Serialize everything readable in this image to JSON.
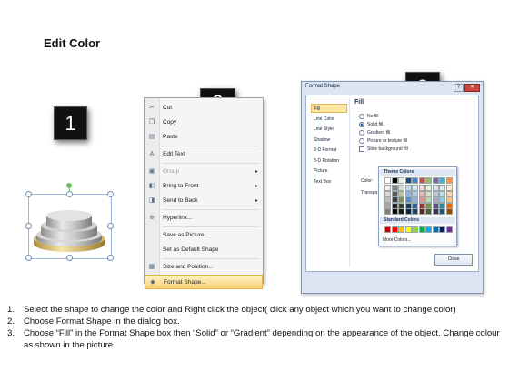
{
  "page": {
    "title": "Edit Color",
    "badges": [
      "1",
      "2",
      "3"
    ]
  },
  "context_menu": {
    "items": [
      {
        "label": "Cut",
        "icon": "scissors-icon",
        "glyph": "✂"
      },
      {
        "label": "Copy",
        "icon": "copy-icon",
        "glyph": "❐"
      },
      {
        "label": "Paste",
        "icon": "paste-icon",
        "glyph": "▤"
      },
      {
        "label": "Edit Text",
        "icon": "edit-text-icon",
        "glyph": "A"
      },
      {
        "label": "Group",
        "icon": "group-icon",
        "glyph": "▣",
        "disabled": true,
        "submenu": true
      },
      {
        "label": "Bring to Front",
        "icon": "bring-front-icon",
        "glyph": "◧",
        "submenu": true
      },
      {
        "label": "Send to Back",
        "icon": "send-back-icon",
        "glyph": "◨",
        "submenu": true
      },
      {
        "label": "Hyperlink...",
        "icon": "hyperlink-icon",
        "glyph": "⊕"
      },
      {
        "label": "Save as Picture...",
        "icon": "",
        "glyph": ""
      },
      {
        "label": "Set as Default Shape",
        "icon": "",
        "glyph": ""
      },
      {
        "label": "Size and Position...",
        "icon": "size-position-icon",
        "glyph": "▦"
      },
      {
        "label": "Format Shape...",
        "icon": "format-shape-icon",
        "glyph": "◆",
        "highlighted": true
      }
    ]
  },
  "dialog": {
    "title": "Format Shape",
    "help_label": "?",
    "close_label": "✕",
    "nav_items": [
      "Fill",
      "Line Color",
      "Line Style",
      "Shadow",
      "3-D Format",
      "3-D Rotation",
      "Picture",
      "Text Box"
    ],
    "fill_heading": "Fill",
    "options": [
      {
        "label": "No fill",
        "type": "radio",
        "selected": false
      },
      {
        "label": "Solid fill",
        "type": "radio",
        "selected": true
      },
      {
        "label": "Gradient fill",
        "type": "radio",
        "selected": false
      },
      {
        "label": "Picture or texture fill",
        "type": "radio",
        "selected": false
      },
      {
        "label": "Slide background fill",
        "type": "checkbox",
        "selected": false
      }
    ],
    "color_label": "Color:",
    "transparency_label": "Transpa",
    "close_button": "Close"
  },
  "picker": {
    "theme_label": "Theme Colors",
    "standard_label": "Standard Colors",
    "more_label": "More Colors...",
    "theme_top": [
      "#ffffff",
      "#000000",
      "#eeece1",
      "#1f497d",
      "#4f81bd",
      "#c0504d",
      "#9bbb59",
      "#8064a2",
      "#4bacc6",
      "#f79646"
    ],
    "theme_shades": [
      [
        "#f2f2f2",
        "#7f7f7f",
        "#ddd9c3",
        "#c6d9f0",
        "#dbe5f1",
        "#f2dcdb",
        "#ebf1dd",
        "#e5e0ec",
        "#dbeef3",
        "#fdeada"
      ],
      [
        "#d8d8d8",
        "#595959",
        "#c4bd97",
        "#8db3e2",
        "#b8cce4",
        "#e5b9b7",
        "#d7e3bc",
        "#ccc1d9",
        "#b7dde8",
        "#fbd5b5"
      ],
      [
        "#bfbfbf",
        "#3f3f3f",
        "#938953",
        "#548dd4",
        "#95b3d7",
        "#d99694",
        "#c3d69b",
        "#b2a2c7",
        "#92cddc",
        "#fac08f"
      ],
      [
        "#a5a5a5",
        "#262626",
        "#494429",
        "#17365d",
        "#366092",
        "#953734",
        "#76923c",
        "#5f497a",
        "#31859b",
        "#e36c09"
      ],
      [
        "#7f7f7f",
        "#0c0c0c",
        "#1d1b10",
        "#0f243e",
        "#244061",
        "#632423",
        "#4f6128",
        "#3f3151",
        "#205867",
        "#974806"
      ]
    ],
    "standard": [
      "#c00000",
      "#ff0000",
      "#ffc000",
      "#ffff00",
      "#92d050",
      "#00b050",
      "#00b0f0",
      "#0070c0",
      "#002060",
      "#7030a0"
    ]
  },
  "instructions": [
    {
      "num": "1.",
      "text": "Select the shape to change the color and Right click the object( click any object which you want to change color)"
    },
    {
      "num": "2.",
      "text": "Choose Format Shape in the dialog box."
    },
    {
      "num": "3.",
      "text": "Choose “Fill” in the Format Shape box then “Solid” or “Gradient” depending on the appearance of the object. Change colour as shown in the picture."
    }
  ]
}
